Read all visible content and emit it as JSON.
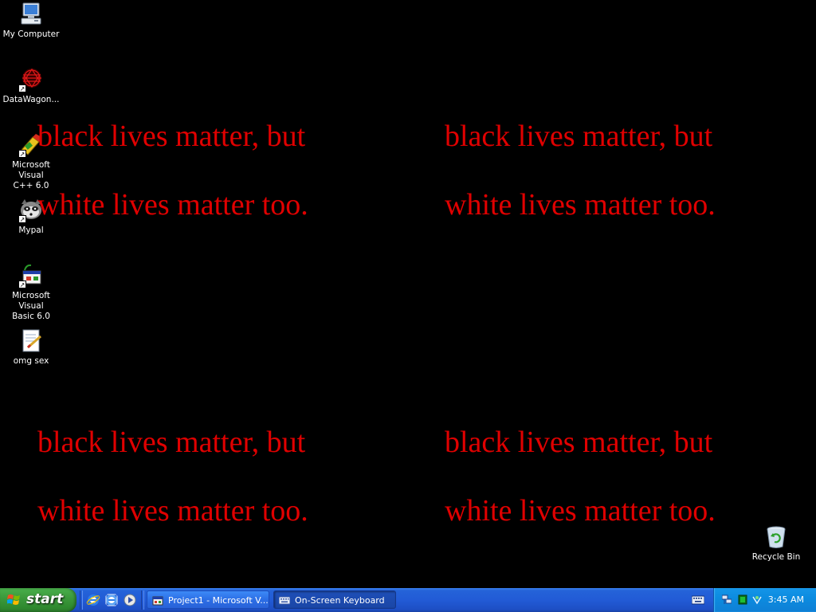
{
  "desktop": {
    "icons": [
      {
        "label_lines": [
          "My Computer"
        ],
        "icon": "my-computer-icon"
      },
      {
        "label_lines": [
          "DataWagon..."
        ],
        "icon": "datawagon-icon"
      },
      {
        "label_lines": [
          "Microsoft Visual",
          "C++ 6.0"
        ],
        "icon": "visual-cpp-icon"
      },
      {
        "label_lines": [
          "Mypal"
        ],
        "icon": "mypal-icon"
      },
      {
        "label_lines": [
          "Microsoft Visual",
          "Basic 6.0"
        ],
        "icon": "visual-basic-icon"
      },
      {
        "label_lines": [
          "omg sex"
        ],
        "icon": "text-file-icon"
      }
    ],
    "recycle_bin": {
      "label": "Recycle Bin",
      "icon": "recycle-bin-icon"
    },
    "messages": [
      {
        "line1": "black lives matter, but",
        "line2": "white lives matter too."
      },
      {
        "line1": "black lives matter, but",
        "line2": "white lives matter too."
      },
      {
        "line1": "black lives matter, but",
        "line2": "white lives matter too."
      },
      {
        "line1": "black lives matter, but",
        "line2": "white lives matter too."
      }
    ],
    "text_color": "#e00000"
  },
  "taskbar": {
    "start_label": "start",
    "quick_launch": [
      "internet-explorer-icon",
      "internet-explorer-icon",
      "media-player-icon"
    ],
    "buttons": [
      {
        "label": "Project1 - Microsoft V...",
        "icon": "visual-basic-icon",
        "active": false
      },
      {
        "label": "On-Screen Keyboard",
        "icon": "keyboard-icon",
        "active": true
      }
    ],
    "clock": "3:45 AM",
    "tray_icons": [
      "keyboard-icon",
      "network-icon",
      "green-square-icon",
      "wireless-icon"
    ]
  }
}
